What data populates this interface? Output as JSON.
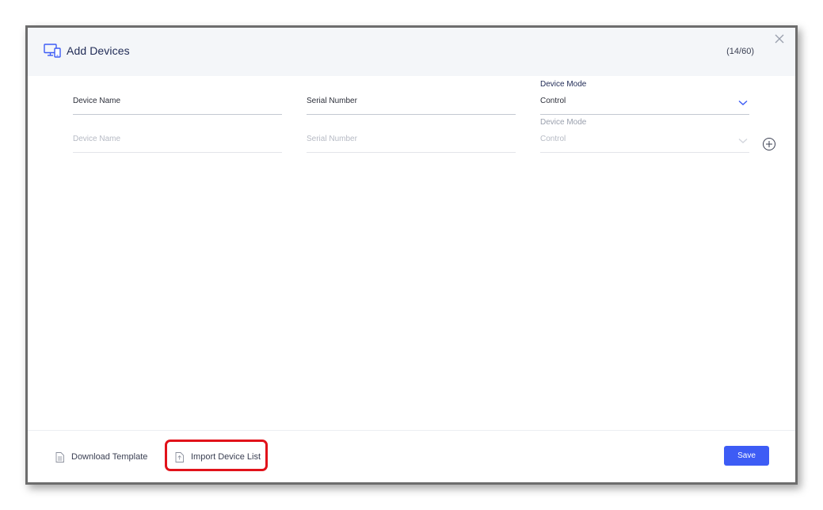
{
  "modal": {
    "title": "Add Devices",
    "count": "(14/60)",
    "header_icon": "devices-icon",
    "close_icon": "close-icon"
  },
  "rows": [
    {
      "device_name_placeholder": "Device Name",
      "serial_number_placeholder": "Serial Number",
      "device_mode_label": "Device Mode",
      "device_mode_value": "Control",
      "state": "active"
    },
    {
      "device_name_placeholder": "Device Name",
      "serial_number_placeholder": "Serial Number",
      "device_mode_label": "Device Mode",
      "device_mode_value": "Control",
      "state": "disabled"
    }
  ],
  "add_row_icon": "plus-circle-icon",
  "footer": {
    "download_template_label": "Download Template",
    "download_template_icon": "document-icon",
    "import_device_list_label": "Import Device List",
    "import_device_list_icon": "upload-file-icon",
    "save_label": "Save"
  },
  "colors": {
    "accent": "#3d5cf5",
    "highlight": "#e1121a",
    "title": "#1f2a55",
    "header_bg": "#f4f6f9"
  }
}
